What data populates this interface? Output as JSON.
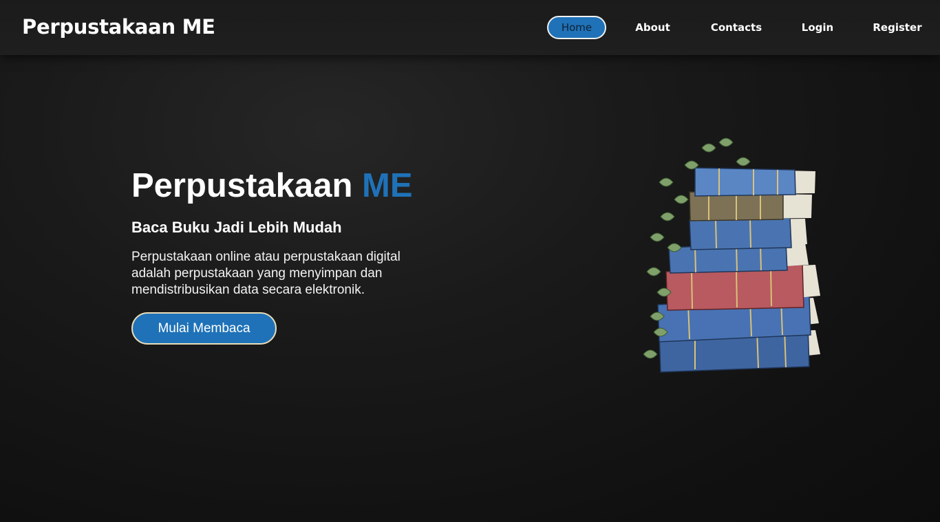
{
  "navbar": {
    "brand": "Perpustakaan ME",
    "links": [
      {
        "label": "Home",
        "active": true
      },
      {
        "label": "About"
      },
      {
        "label": "Contacts"
      },
      {
        "label": "Login"
      },
      {
        "label": "Register"
      }
    ]
  },
  "hero": {
    "title_main": "Perpustakaan",
    "title_accent": "ME",
    "subtitle": "Baca Buku Jadi Lebih Mudah",
    "description": "Perpustakaan online atau perpustakaan digital adalah perpustakaan yang menyimpan dan mendistribusikan data secara elektronik.",
    "cta_label": "Mulai Membaca",
    "illustration": "book-stack-with-ivy-icon"
  },
  "colors": {
    "accent": "#1f72b8",
    "background": "#141414",
    "navbar": "#1d1d1d",
    "cta_border": "#e9ddb8"
  }
}
